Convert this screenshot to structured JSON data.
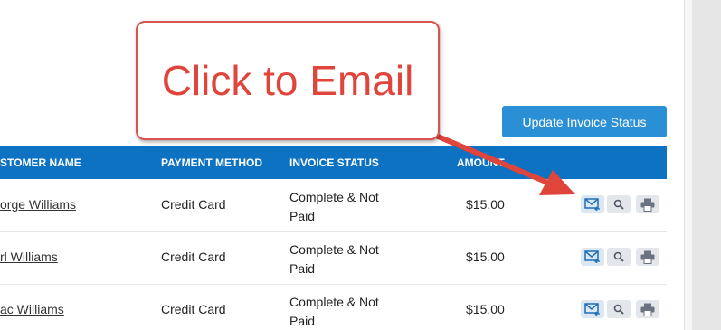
{
  "toolbar": {
    "update_status_label": "Update Invoice Status"
  },
  "table": {
    "headers": [
      "STOMER NAME",
      "PAYMENT METHOD",
      "INVOICE STATUS",
      "AMOUNT"
    ],
    "rows": [
      {
        "customer": "orge Williams",
        "payment": "Credit Card",
        "status_line1": "Complete & Not",
        "status_line2": "Paid",
        "amount": "$15.00"
      },
      {
        "customer": "rl Williams",
        "payment": "Credit Card",
        "status_line1": "Complete & Not",
        "status_line2": "Paid",
        "amount": "$15.00"
      },
      {
        "customer": "ac Williams",
        "payment": "Credit Card",
        "status_line1": "Complete & Not",
        "status_line2": "Paid",
        "amount": "$15.00"
      }
    ],
    "row_actions": [
      "email-icon",
      "search-icon",
      "print-icon"
    ]
  },
  "annotation": {
    "callout_text": "Click to Email",
    "color": "#e0453c"
  },
  "colors": {
    "header_bg": "#0d72c2",
    "button_bg": "#2b8fd6"
  }
}
